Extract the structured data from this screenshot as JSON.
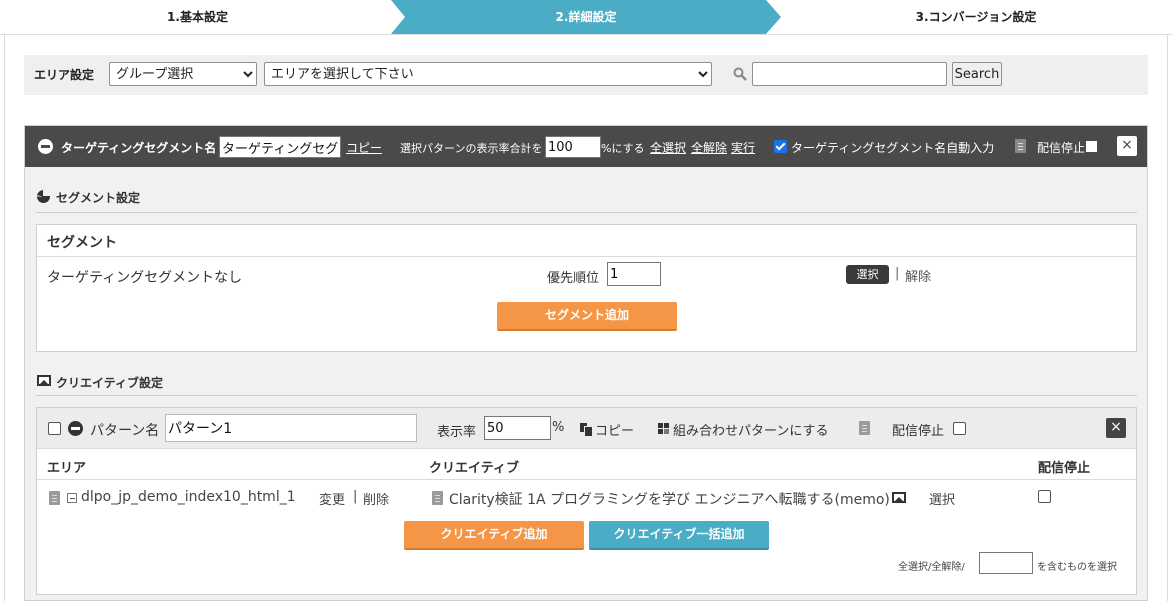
{
  "steps": [
    "1.基本設定",
    "2.詳細設定",
    "3.コンバージョン設定"
  ],
  "area_bar": {
    "label": "エリア設定",
    "group_select": "グループ選択",
    "area_select": "エリアを選択して下さい",
    "search_value": "",
    "search_button": "Search"
  },
  "segment_panel": {
    "name_label": "ターゲティングセグメント名",
    "name_value": "ターゲティングセグ",
    "copy_link": "コピー",
    "rate_prefix": "選択パターンの表示率合計を",
    "rate_value": "100",
    "rate_suffix": "%にする",
    "select_all": "全選択",
    "clear_all": "全解除",
    "execute": "実行",
    "auto_input_checked": true,
    "auto_input_label": "ターゲティングセグメント名自動入力",
    "stop_label": "配信停止",
    "close": "×"
  },
  "segment_section": {
    "title": "セグメント設定",
    "box_title": "セグメント",
    "none_text": "ターゲティングセグメントなし",
    "priority_label": "優先順位",
    "priority_value": "1",
    "select_button": "選択",
    "separator": "|",
    "release_link": "解除",
    "add_button": "セグメント追加"
  },
  "creative_section": {
    "title": "クリエイティブ設定",
    "pattern": {
      "name_label": "パターン名",
      "name_value": "パターン1",
      "rate_label": "表示率",
      "rate_value": "50",
      "pct": "%",
      "copy": "コピー",
      "combo": "組み合わせパターンにする",
      "stop_label": "配信停止",
      "close": "×",
      "columns": [
        "エリア",
        "クリエイティブ",
        "配信停止"
      ],
      "row": {
        "area": "dlpo_jp_demo_index10_html_1",
        "change": "変更",
        "separator": "|",
        "delete": "削除",
        "creative": "Clarity検証 1A プログラミングを学び エンジニアへ転職する(memo)",
        "select": "選択"
      },
      "add_button": "クリエイティブ追加",
      "bulk_add_button": "クリエイティブ一括追加",
      "bulk_text_prefix": "全選択/全解除/",
      "bulk_text_suffix": "を含むものを選択"
    }
  },
  "colors": {
    "step_active": "#4aacc5",
    "panel_header": "#4a4a4a",
    "orange_button": "#f59646",
    "blue_button": "#4aacc5"
  },
  "icons": [
    "search-icon",
    "minus-circle-icon",
    "pie-chart-icon",
    "image-icon",
    "document-icon",
    "copy-icon",
    "combo-icon",
    "close-icon"
  ]
}
